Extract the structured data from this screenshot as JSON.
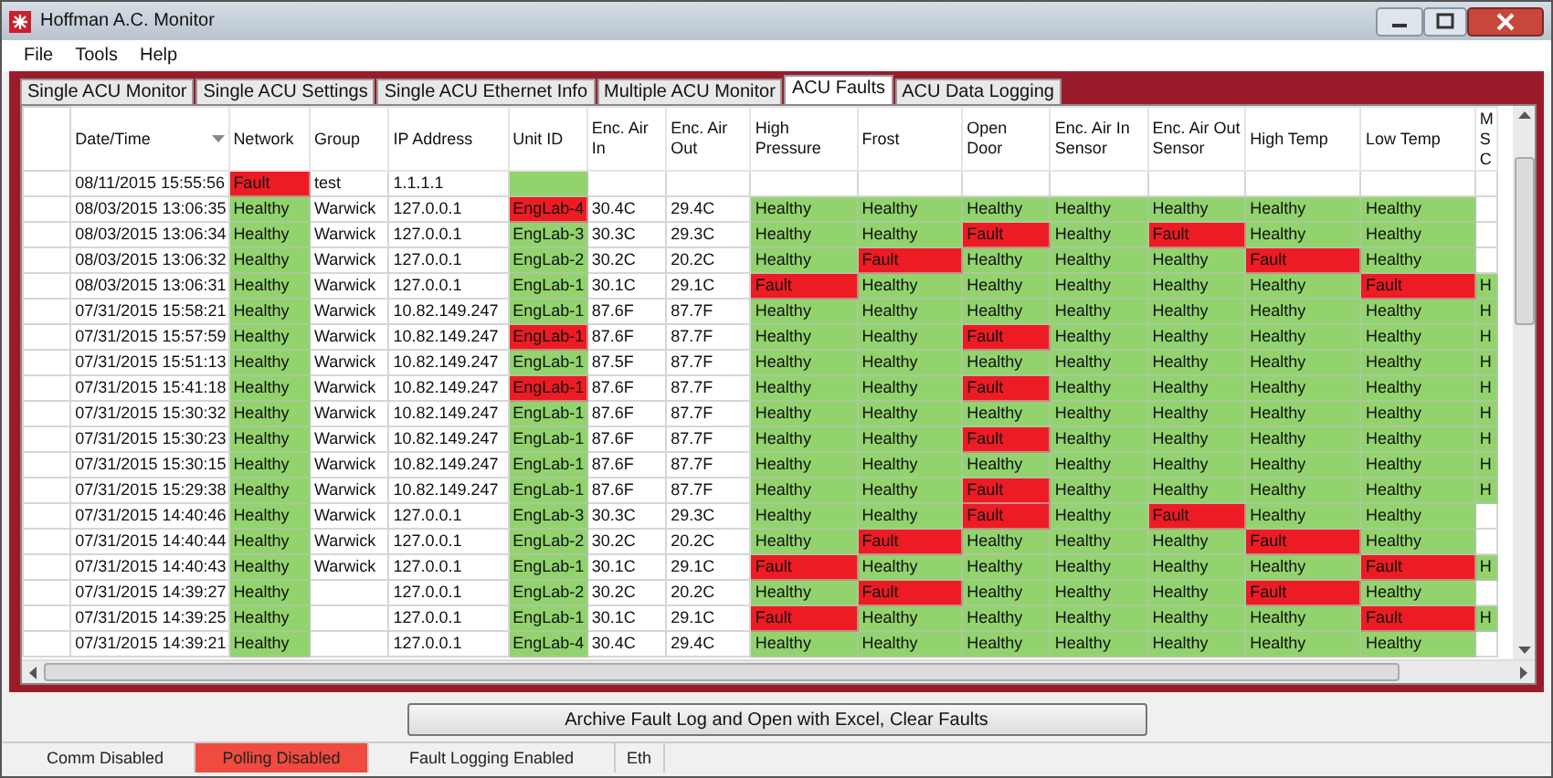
{
  "window": {
    "title": "Hoffman A.C. Monitor"
  },
  "menu": [
    "File",
    "Tools",
    "Help"
  ],
  "tabs": [
    {
      "label": "Single ACU Monitor",
      "selected": false
    },
    {
      "label": "Single ACU Settings",
      "selected": false
    },
    {
      "label": "Single ACU Ethernet Info",
      "selected": false
    },
    {
      "label": "Multiple ACU Monitor",
      "selected": false
    },
    {
      "label": "ACU Faults",
      "selected": true
    },
    {
      "label": "ACU Data Logging",
      "selected": false
    }
  ],
  "table": {
    "columns": [
      {
        "label": "Date/Time",
        "sorted": true
      },
      {
        "label": "Network",
        "sorted": false
      },
      {
        "label": "Group",
        "sorted": false
      },
      {
        "label": "IP Address",
        "sorted": false
      },
      {
        "label": "Unit ID",
        "sorted": false
      },
      {
        "label": "Enc. Air In",
        "sorted": false
      },
      {
        "label": "Enc. Air Out",
        "sorted": false
      },
      {
        "label": "High Pressure",
        "sorted": false
      },
      {
        "label": "Frost",
        "sorted": false
      },
      {
        "label": "Open Door",
        "sorted": false
      },
      {
        "label": "Enc. Air In Sensor",
        "sorted": false
      },
      {
        "label": "Enc. Air Out Sensor",
        "sorted": false
      },
      {
        "label": "High Temp",
        "sorted": false
      },
      {
        "label": "Low Temp",
        "sorted": false
      },
      {
        "label": "M S C",
        "sorted": false
      }
    ],
    "rows": [
      {
        "cells": [
          {
            "t": "08/11/2015 15:55:56"
          },
          {
            "t": "Fault",
            "fault": true
          },
          {
            "t": "test"
          },
          {
            "t": "1.1.1.1"
          },
          {
            "fault": false
          },
          {},
          {},
          {},
          {},
          {},
          {},
          {},
          {},
          {},
          {}
        ]
      },
      {
        "cells": [
          {
            "t": "08/03/2015 13:06:35"
          },
          {
            "t": "Healthy",
            "fault": false
          },
          {
            "t": "Warwick"
          },
          {
            "t": "127.0.0.1"
          },
          {
            "t": "EngLab-4",
            "fault": true
          },
          {
            "t": "30.4C"
          },
          {
            "t": "29.4C"
          },
          {
            "t": "Healthy",
            "fault": false
          },
          {
            "t": "Healthy",
            "fault": false
          },
          {
            "t": "Healthy",
            "fault": false
          },
          {
            "t": "Healthy",
            "fault": false
          },
          {
            "t": "Healthy",
            "fault": false
          },
          {
            "t": "Healthy",
            "fault": false
          },
          {
            "t": "Healthy",
            "fault": false
          },
          {}
        ]
      },
      {
        "cells": [
          {
            "t": "08/03/2015 13:06:34"
          },
          {
            "t": "Healthy",
            "fault": false
          },
          {
            "t": "Warwick"
          },
          {
            "t": "127.0.0.1"
          },
          {
            "t": "EngLab-3",
            "fault": false
          },
          {
            "t": "30.3C"
          },
          {
            "t": "29.3C"
          },
          {
            "t": "Healthy",
            "fault": false
          },
          {
            "t": "Healthy",
            "fault": false
          },
          {
            "t": "Fault",
            "fault": true
          },
          {
            "t": "Healthy",
            "fault": false
          },
          {
            "t": "Fault",
            "fault": true
          },
          {
            "t": "Healthy",
            "fault": false
          },
          {
            "t": "Healthy",
            "fault": false
          },
          {}
        ]
      },
      {
        "cells": [
          {
            "t": "08/03/2015 13:06:32"
          },
          {
            "t": "Healthy",
            "fault": false
          },
          {
            "t": "Warwick"
          },
          {
            "t": "127.0.0.1"
          },
          {
            "t": "EngLab-2",
            "fault": false
          },
          {
            "t": "30.2C"
          },
          {
            "t": "20.2C"
          },
          {
            "t": "Healthy",
            "fault": false
          },
          {
            "t": "Fault",
            "fault": true
          },
          {
            "t": "Healthy",
            "fault": false
          },
          {
            "t": "Healthy",
            "fault": false
          },
          {
            "t": "Healthy",
            "fault": false
          },
          {
            "t": "Fault",
            "fault": true
          },
          {
            "t": "Healthy",
            "fault": false
          },
          {}
        ]
      },
      {
        "cells": [
          {
            "t": "08/03/2015 13:06:31"
          },
          {
            "t": "Healthy",
            "fault": false
          },
          {
            "t": "Warwick"
          },
          {
            "t": "127.0.0.1"
          },
          {
            "t": "EngLab-1",
            "fault": false
          },
          {
            "t": "30.1C"
          },
          {
            "t": "29.1C"
          },
          {
            "t": "Fault",
            "fault": true
          },
          {
            "t": "Healthy",
            "fault": false
          },
          {
            "t": "Healthy",
            "fault": false
          },
          {
            "t": "Healthy",
            "fault": false
          },
          {
            "t": "Healthy",
            "fault": false
          },
          {
            "t": "Healthy",
            "fault": false
          },
          {
            "t": "Fault",
            "fault": true
          },
          {
            "t": "H",
            "fault": false
          }
        ]
      },
      {
        "cells": [
          {
            "t": "07/31/2015 15:58:21"
          },
          {
            "t": "Healthy",
            "fault": false
          },
          {
            "t": "Warwick"
          },
          {
            "t": "10.82.149.247"
          },
          {
            "t": "EngLab-1",
            "fault": false
          },
          {
            "t": "87.6F"
          },
          {
            "t": "87.7F"
          },
          {
            "t": "Healthy",
            "fault": false
          },
          {
            "t": "Healthy",
            "fault": false
          },
          {
            "t": "Healthy",
            "fault": false
          },
          {
            "t": "Healthy",
            "fault": false
          },
          {
            "t": "Healthy",
            "fault": false
          },
          {
            "t": "Healthy",
            "fault": false
          },
          {
            "t": "Healthy",
            "fault": false
          },
          {
            "t": "H",
            "fault": false
          }
        ]
      },
      {
        "cells": [
          {
            "t": "07/31/2015 15:57:59"
          },
          {
            "t": "Healthy",
            "fault": false
          },
          {
            "t": "Warwick"
          },
          {
            "t": "10.82.149.247"
          },
          {
            "t": "EngLab-1",
            "fault": true
          },
          {
            "t": "87.6F"
          },
          {
            "t": "87.7F"
          },
          {
            "t": "Healthy",
            "fault": false
          },
          {
            "t": "Healthy",
            "fault": false
          },
          {
            "t": "Fault",
            "fault": true
          },
          {
            "t": "Healthy",
            "fault": false
          },
          {
            "t": "Healthy",
            "fault": false
          },
          {
            "t": "Healthy",
            "fault": false
          },
          {
            "t": "Healthy",
            "fault": false
          },
          {
            "t": "H",
            "fault": false
          }
        ]
      },
      {
        "cells": [
          {
            "t": "07/31/2015 15:51:13"
          },
          {
            "t": "Healthy",
            "fault": false
          },
          {
            "t": "Warwick"
          },
          {
            "t": "10.82.149.247"
          },
          {
            "t": "EngLab-1",
            "fault": false
          },
          {
            "t": "87.5F"
          },
          {
            "t": "87.7F"
          },
          {
            "t": "Healthy",
            "fault": false
          },
          {
            "t": "Healthy",
            "fault": false
          },
          {
            "t": "Healthy",
            "fault": false
          },
          {
            "t": "Healthy",
            "fault": false
          },
          {
            "t": "Healthy",
            "fault": false
          },
          {
            "t": "Healthy",
            "fault": false
          },
          {
            "t": "Healthy",
            "fault": false
          },
          {
            "t": "H",
            "fault": false
          }
        ]
      },
      {
        "cells": [
          {
            "t": "07/31/2015 15:41:18"
          },
          {
            "t": "Healthy",
            "fault": false
          },
          {
            "t": "Warwick"
          },
          {
            "t": "10.82.149.247"
          },
          {
            "t": "EngLab-1",
            "fault": true
          },
          {
            "t": "87.6F"
          },
          {
            "t": "87.7F"
          },
          {
            "t": "Healthy",
            "fault": false
          },
          {
            "t": "Healthy",
            "fault": false
          },
          {
            "t": "Fault",
            "fault": true
          },
          {
            "t": "Healthy",
            "fault": false
          },
          {
            "t": "Healthy",
            "fault": false
          },
          {
            "t": "Healthy",
            "fault": false
          },
          {
            "t": "Healthy",
            "fault": false
          },
          {
            "t": "H",
            "fault": false
          }
        ]
      },
      {
        "cells": [
          {
            "t": "07/31/2015 15:30:32"
          },
          {
            "t": "Healthy",
            "fault": false
          },
          {
            "t": "Warwick"
          },
          {
            "t": "10.82.149.247"
          },
          {
            "t": "EngLab-1",
            "fault": false
          },
          {
            "t": "87.6F"
          },
          {
            "t": "87.7F"
          },
          {
            "t": "Healthy",
            "fault": false
          },
          {
            "t": "Healthy",
            "fault": false
          },
          {
            "t": "Healthy",
            "fault": false
          },
          {
            "t": "Healthy",
            "fault": false
          },
          {
            "t": "Healthy",
            "fault": false
          },
          {
            "t": "Healthy",
            "fault": false
          },
          {
            "t": "Healthy",
            "fault": false
          },
          {
            "t": "H",
            "fault": false
          }
        ]
      },
      {
        "cells": [
          {
            "t": "07/31/2015 15:30:23"
          },
          {
            "t": "Healthy",
            "fault": false
          },
          {
            "t": "Warwick"
          },
          {
            "t": "10.82.149.247"
          },
          {
            "t": "EngLab-1",
            "fault": false
          },
          {
            "t": "87.6F"
          },
          {
            "t": "87.7F"
          },
          {
            "t": "Healthy",
            "fault": false
          },
          {
            "t": "Healthy",
            "fault": false
          },
          {
            "t": "Fault",
            "fault": true
          },
          {
            "t": "Healthy",
            "fault": false
          },
          {
            "t": "Healthy",
            "fault": false
          },
          {
            "t": "Healthy",
            "fault": false
          },
          {
            "t": "Healthy",
            "fault": false
          },
          {
            "t": "H",
            "fault": false
          }
        ]
      },
      {
        "cells": [
          {
            "t": "07/31/2015 15:30:15"
          },
          {
            "t": "Healthy",
            "fault": false
          },
          {
            "t": "Warwick"
          },
          {
            "t": "10.82.149.247"
          },
          {
            "t": "EngLab-1",
            "fault": false
          },
          {
            "t": "87.6F"
          },
          {
            "t": "87.7F"
          },
          {
            "t": "Healthy",
            "fault": false
          },
          {
            "t": "Healthy",
            "fault": false
          },
          {
            "t": "Healthy",
            "fault": false
          },
          {
            "t": "Healthy",
            "fault": false
          },
          {
            "t": "Healthy",
            "fault": false
          },
          {
            "t": "Healthy",
            "fault": false
          },
          {
            "t": "Healthy",
            "fault": false
          },
          {
            "t": "H",
            "fault": false
          }
        ]
      },
      {
        "cells": [
          {
            "t": "07/31/2015 15:29:38"
          },
          {
            "t": "Healthy",
            "fault": false
          },
          {
            "t": "Warwick"
          },
          {
            "t": "10.82.149.247"
          },
          {
            "t": "EngLab-1",
            "fault": false
          },
          {
            "t": "87.6F"
          },
          {
            "t": "87.7F"
          },
          {
            "t": "Healthy",
            "fault": false
          },
          {
            "t": "Healthy",
            "fault": false
          },
          {
            "t": "Fault",
            "fault": true
          },
          {
            "t": "Healthy",
            "fault": false
          },
          {
            "t": "Healthy",
            "fault": false
          },
          {
            "t": "Healthy",
            "fault": false
          },
          {
            "t": "Healthy",
            "fault": false
          },
          {
            "t": "H",
            "fault": false
          }
        ]
      },
      {
        "cells": [
          {
            "t": "07/31/2015 14:40:46"
          },
          {
            "t": "Healthy",
            "fault": false
          },
          {
            "t": "Warwick"
          },
          {
            "t": "127.0.0.1"
          },
          {
            "t": "EngLab-3",
            "fault": false
          },
          {
            "t": "30.3C"
          },
          {
            "t": "29.3C"
          },
          {
            "t": "Healthy",
            "fault": false
          },
          {
            "t": "Healthy",
            "fault": false
          },
          {
            "t": "Fault",
            "fault": true
          },
          {
            "t": "Healthy",
            "fault": false
          },
          {
            "t": "Fault",
            "fault": true
          },
          {
            "t": "Healthy",
            "fault": false
          },
          {
            "t": "Healthy",
            "fault": false
          },
          {}
        ]
      },
      {
        "cells": [
          {
            "t": "07/31/2015 14:40:44"
          },
          {
            "t": "Healthy",
            "fault": false
          },
          {
            "t": "Warwick"
          },
          {
            "t": "127.0.0.1"
          },
          {
            "t": "EngLab-2",
            "fault": false
          },
          {
            "t": "30.2C"
          },
          {
            "t": "20.2C"
          },
          {
            "t": "Healthy",
            "fault": false
          },
          {
            "t": "Fault",
            "fault": true
          },
          {
            "t": "Healthy",
            "fault": false
          },
          {
            "t": "Healthy",
            "fault": false
          },
          {
            "t": "Healthy",
            "fault": false
          },
          {
            "t": "Fault",
            "fault": true
          },
          {
            "t": "Healthy",
            "fault": false
          },
          {}
        ]
      },
      {
        "cells": [
          {
            "t": "07/31/2015 14:40:43"
          },
          {
            "t": "Healthy",
            "fault": false
          },
          {
            "t": "Warwick"
          },
          {
            "t": "127.0.0.1"
          },
          {
            "t": "EngLab-1",
            "fault": false
          },
          {
            "t": "30.1C"
          },
          {
            "t": "29.1C"
          },
          {
            "t": "Fault",
            "fault": true
          },
          {
            "t": "Healthy",
            "fault": false
          },
          {
            "t": "Healthy",
            "fault": false
          },
          {
            "t": "Healthy",
            "fault": false
          },
          {
            "t": "Healthy",
            "fault": false
          },
          {
            "t": "Healthy",
            "fault": false
          },
          {
            "t": "Fault",
            "fault": true
          },
          {
            "t": "H",
            "fault": false
          }
        ]
      },
      {
        "cells": [
          {
            "t": "07/31/2015 14:39:27"
          },
          {
            "t": "Healthy",
            "fault": false
          },
          {},
          {
            "t": "127.0.0.1"
          },
          {
            "t": "EngLab-2",
            "fault": false
          },
          {
            "t": "30.2C"
          },
          {
            "t": "20.2C"
          },
          {
            "t": "Healthy",
            "fault": false
          },
          {
            "t": "Fault",
            "fault": true
          },
          {
            "t": "Healthy",
            "fault": false
          },
          {
            "t": "Healthy",
            "fault": false
          },
          {
            "t": "Healthy",
            "fault": false
          },
          {
            "t": "Fault",
            "fault": true
          },
          {
            "t": "Healthy",
            "fault": false
          },
          {}
        ]
      },
      {
        "cells": [
          {
            "t": "07/31/2015 14:39:25"
          },
          {
            "t": "Healthy",
            "fault": false
          },
          {},
          {
            "t": "127.0.0.1"
          },
          {
            "t": "EngLab-1",
            "fault": false
          },
          {
            "t": "30.1C"
          },
          {
            "t": "29.1C"
          },
          {
            "t": "Fault",
            "fault": true
          },
          {
            "t": "Healthy",
            "fault": false
          },
          {
            "t": "Healthy",
            "fault": false
          },
          {
            "t": "Healthy",
            "fault": false
          },
          {
            "t": "Healthy",
            "fault": false
          },
          {
            "t": "Healthy",
            "fault": false
          },
          {
            "t": "Fault",
            "fault": true
          },
          {
            "t": "H",
            "fault": false
          }
        ]
      },
      {
        "cells": [
          {
            "t": "07/31/2015 14:39:21"
          },
          {
            "t": "Healthy",
            "fault": false
          },
          {},
          {
            "t": "127.0.0.1"
          },
          {
            "t": "EngLab-4",
            "fault": false
          },
          {
            "t": "30.4C"
          },
          {
            "t": "29.4C"
          },
          {
            "t": "Healthy",
            "fault": false
          },
          {
            "t": "Healthy",
            "fault": false
          },
          {
            "t": "Healthy",
            "fault": false
          },
          {
            "t": "Healthy",
            "fault": false
          },
          {
            "t": "Healthy",
            "fault": false
          },
          {
            "t": "Healthy",
            "fault": false
          },
          {
            "t": "Healthy",
            "fault": false
          },
          {}
        ]
      }
    ]
  },
  "action_button": "Archive Fault Log and Open with Excel, Clear Faults",
  "status_bar": [
    {
      "text": "Comm Disabled",
      "alert": false
    },
    {
      "text": "Polling Disabled",
      "alert": true
    },
    {
      "text": "Fault Logging Enabled",
      "alert": false
    },
    {
      "text": "Eth",
      "alert": false
    }
  ]
}
